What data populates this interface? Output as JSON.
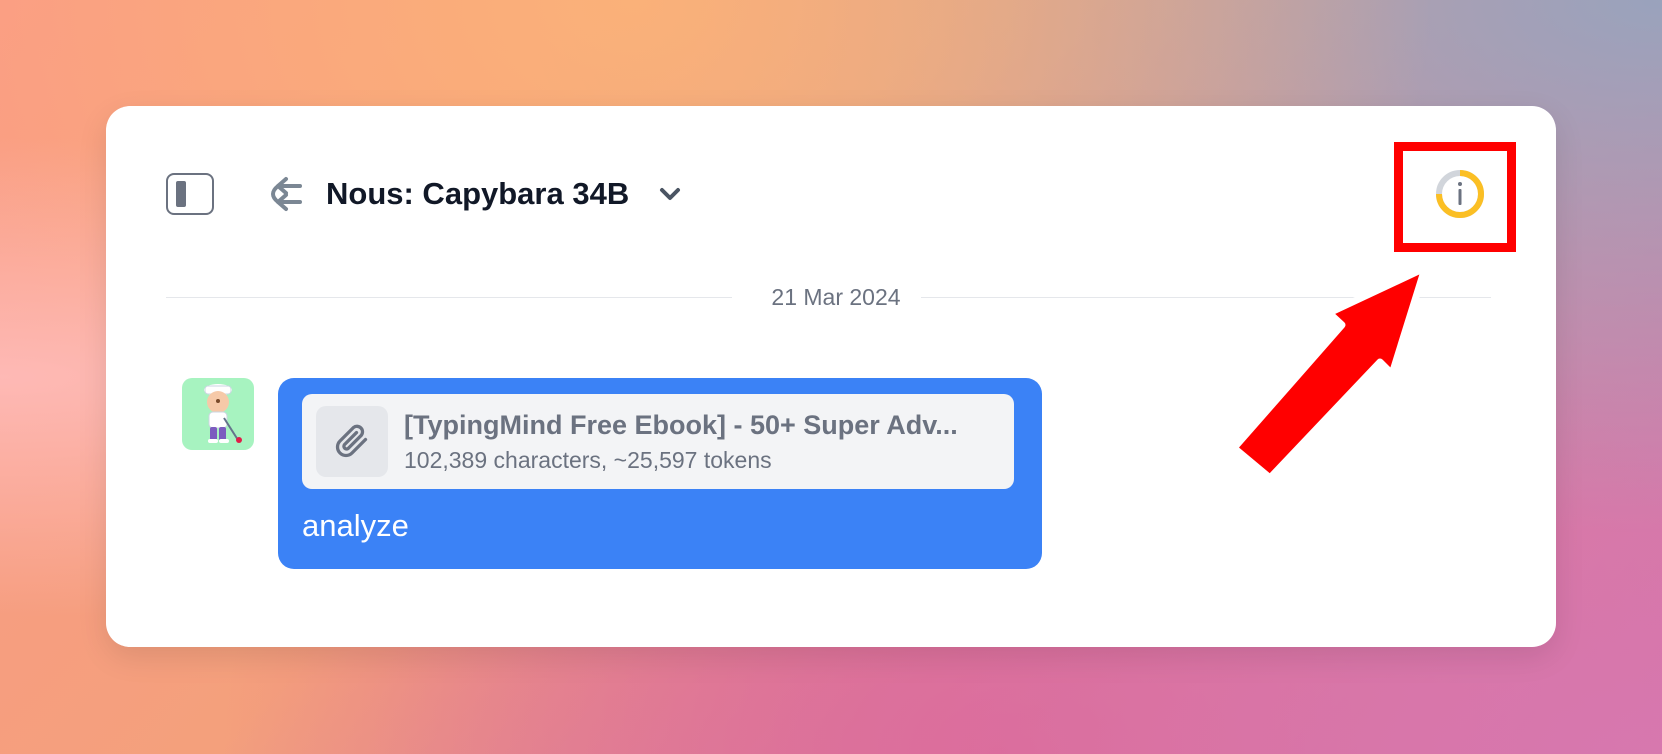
{
  "header": {
    "model_name": "Nous: Capybara 34B"
  },
  "date_separator": "21 Mar 2024",
  "message": {
    "attachment_title": "[TypingMind Free Ebook] - 50+ Super Adv...",
    "attachment_meta": "102,389 characters, ~25,597 tokens",
    "text": "analyze"
  },
  "icons": {
    "sidebar": "sidebar-toggle-icon",
    "swap": "swap-icon",
    "dropdown": "chevron-down-icon",
    "info": "info-icon",
    "attachment": "paperclip-icon"
  },
  "colors": {
    "bubble": "#3b82f6",
    "annotation": "#ff0000",
    "info_ring": "#fbbf24"
  }
}
